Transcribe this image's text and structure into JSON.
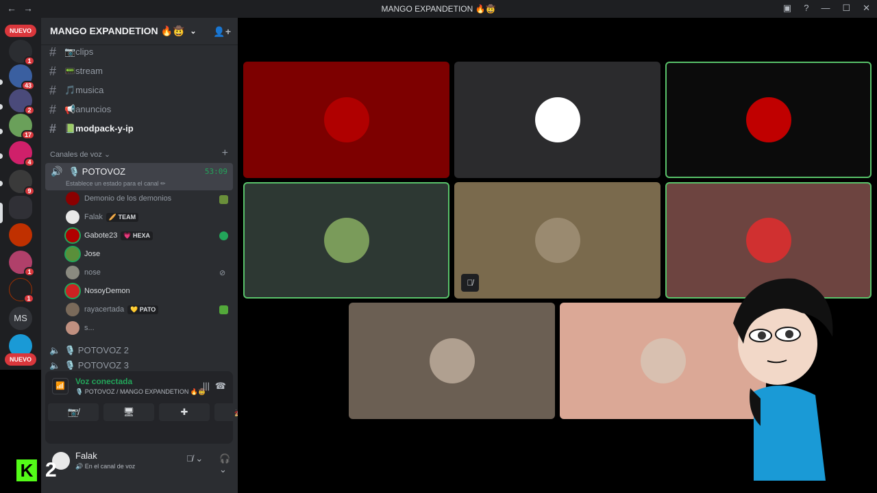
{
  "titlebar": {
    "back": "←",
    "forward": "→",
    "title": "MANGO EXPANDETION 🔥🤠",
    "inbox": "▣",
    "help": "?",
    "min": "—",
    "max": "☐",
    "close": "✕"
  },
  "servers": {
    "new_top": "NUEVO",
    "new_bottom": "NUEVO",
    "ms_label": "MS",
    "badges": [
      "1",
      "43",
      "2",
      "17",
      "4",
      "9",
      "1",
      "1"
    ]
  },
  "server": {
    "name": "MANGO EXPANDETION 🔥🤠",
    "chevron": "⌄",
    "invite_icon": "👤+"
  },
  "channels": [
    {
      "label": "📷clips"
    },
    {
      "label": "📟stream"
    },
    {
      "label": "🎵musica"
    },
    {
      "label": "📢anuncios"
    },
    {
      "label": "📗modpack-y-ip"
    }
  ],
  "voice_category": {
    "label": "Canales de voz ⌄",
    "add": "+"
  },
  "active_voice": {
    "name": "🎙️ POTOVOZ",
    "timer": "53:09",
    "status": "Establece un estado para el canal ✏",
    "speaker": "🔊"
  },
  "members": [
    {
      "name": "Demonio de los demonios",
      "tag": "",
      "color": "#8b0000"
    },
    {
      "name": "Falak",
      "tag": "🥖 TEAM",
      "color": "#e8e8e8"
    },
    {
      "name": "Gabote23",
      "tag": "💗 HEXA",
      "color": "#b00000"
    },
    {
      "name": "Jose",
      "tag": "",
      "color": "#5a8f3a"
    },
    {
      "name": "nose",
      "tag": "",
      "color": "#8a8a80"
    },
    {
      "name": "NosoyDemon",
      "tag": "",
      "color": "#cc2222"
    },
    {
      "name": "rayacertada",
      "tag": "💛 PATO",
      "color": "#7a6a5a"
    },
    {
      "name": "s...",
      "tag": "",
      "color": "#c09080"
    }
  ],
  "other_voice": [
    "🎙️ POTOVOZ 2",
    "🎙️ POTOVOZ 3"
  ],
  "voice_panel": {
    "connected": "Voz conectada",
    "sub": "🎙️ POTOVOZ / MANGO EXPANDETION 🔥🤠",
    "signal": "📶",
    "wave": "|||",
    "hangup": "☎",
    "buttons": [
      "📷̸",
      "🖥",
      "✚",
      "🚀"
    ]
  },
  "user": {
    "name": "Falak",
    "status": "🔊 En el canal de voz",
    "mic": "🎙̸ ⌄",
    "headset": "🎧 ⌄",
    "settings": "⚙"
  },
  "kick": {
    "logo": "K",
    "count": "2"
  },
  "tiles": [
    {
      "bg": "#7d0000",
      "pic": "#b00000",
      "speaking": false
    },
    {
      "bg": "#2b2b2d",
      "pic": "#ffffff",
      "speaking": false
    },
    {
      "bg": "#0b0b0b",
      "pic": "#c00000",
      "speaking": true
    },
    {
      "bg": "#2d3833",
      "pic": "#7a9b5a",
      "speaking": true
    },
    {
      "bg": "#7a6a4d",
      "pic": "#9a8a70",
      "speaking": false
    },
    {
      "bg": "#6d4440",
      "pic": "#d03030",
      "speaking": true
    },
    {
      "bg": "#6b5f53",
      "pic": "#b0a090",
      "speaking": false
    },
    {
      "bg": "#dba896",
      "pic": "#d8c0b0",
      "speaking": false
    }
  ],
  "tile_mute_icon": "🎙̸",
  "colors": {
    "green": "#23a55a",
    "red_badge": "#da373c",
    "kick_green": "#53fc18"
  }
}
